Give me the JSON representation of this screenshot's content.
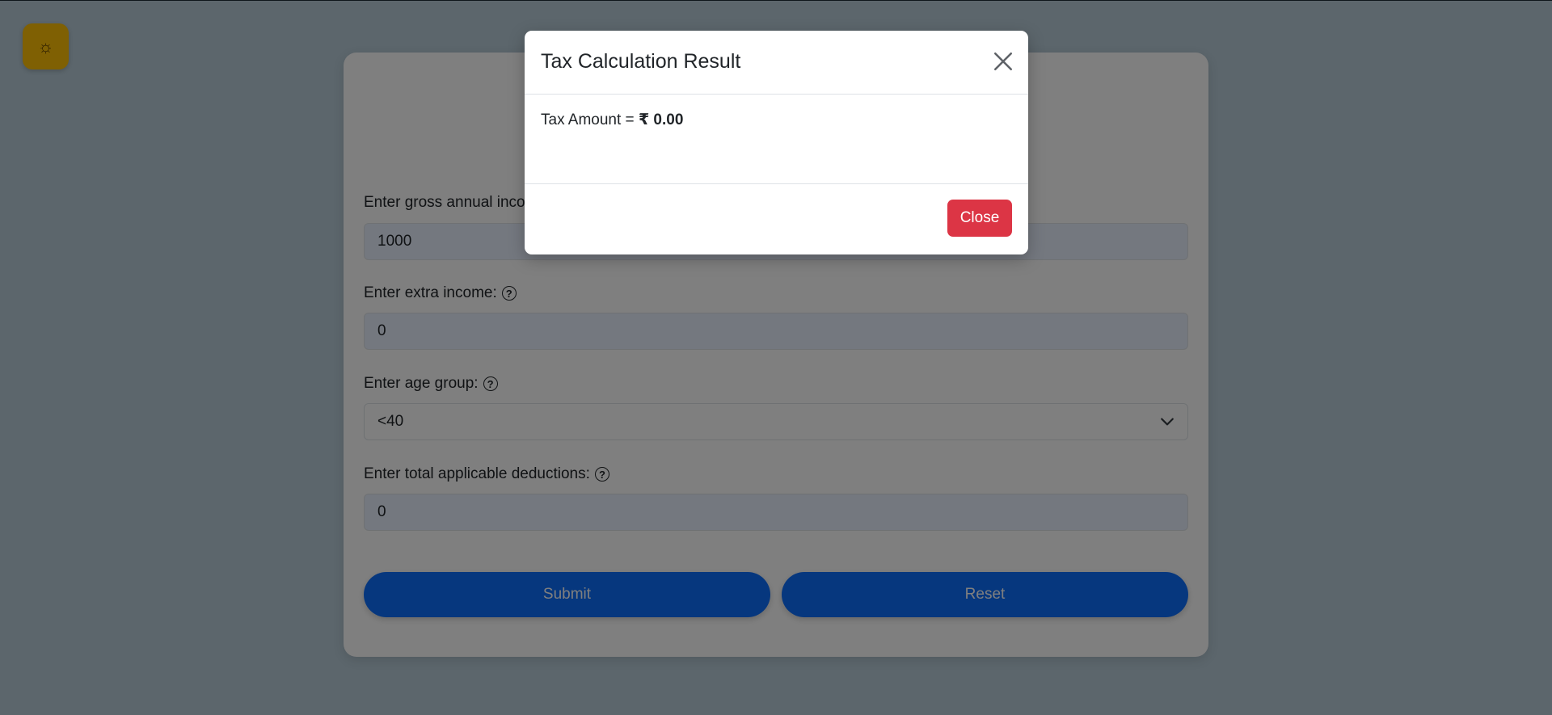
{
  "theme_toggle": {
    "icon": "sun-icon",
    "glyph": "☼",
    "color": "#ffc107"
  },
  "form": {
    "fields": [
      {
        "label": "Enter gross annual income:",
        "value": "1000"
      },
      {
        "label": "Enter extra income:",
        "value": "0"
      },
      {
        "label": "Enter age group:",
        "value": "<40"
      },
      {
        "label": "Enter total applicable deductions:",
        "value": "0"
      }
    ],
    "help_glyph": "?",
    "submit_label": "Submit",
    "reset_label": "Reset"
  },
  "modal": {
    "title": "Tax Calculation Result",
    "result_prefix": "Tax Amount = ",
    "result_value": "₹ 0.00",
    "close_label": "Close"
  },
  "colors": {
    "primary": "#0d6efd",
    "danger": "#dc3545",
    "warning": "#ffc107",
    "page_background": "#b8ccd8"
  }
}
